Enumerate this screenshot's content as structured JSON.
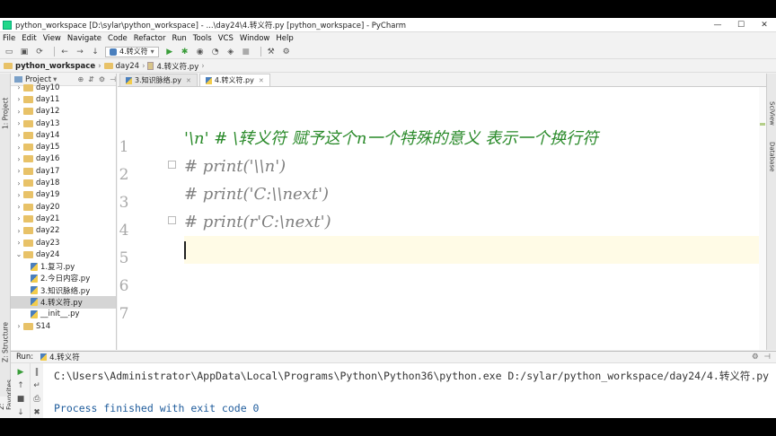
{
  "window": {
    "title": "python_workspace [D:\\sylar\\python_workspace] - ...\\day24\\4.转义符.py [python_workspace] - PyCharm",
    "minimize": "—",
    "maximize": "☐",
    "close": "✕"
  },
  "menu": [
    "File",
    "Edit",
    "View",
    "Navigate",
    "Code",
    "Refactor",
    "Run",
    "Tools",
    "VCS",
    "Window",
    "Help"
  ],
  "toolbar": {
    "run_config": "4.转义符",
    "run_config_arrow": "▾"
  },
  "navbar": {
    "crumbs": [
      "python_workspace",
      "day24",
      "4.转义符.py"
    ]
  },
  "left_tools": {
    "project": "1: Project",
    "structure": "Z: Structure",
    "favorites": "2: Favorites"
  },
  "right_tools": {
    "sciview": "SciView",
    "database": "Database"
  },
  "project_panel": {
    "title": "Project",
    "arrow": "▾",
    "tree": [
      {
        "label": "day10",
        "type": "folder",
        "expanded": false
      },
      {
        "label": "day11",
        "type": "folder",
        "expanded": false
      },
      {
        "label": "day12",
        "type": "folder",
        "expanded": false
      },
      {
        "label": "day13",
        "type": "folder",
        "expanded": false
      },
      {
        "label": "day14",
        "type": "folder",
        "expanded": false
      },
      {
        "label": "day15",
        "type": "folder",
        "expanded": false
      },
      {
        "label": "day16",
        "type": "folder",
        "expanded": false
      },
      {
        "label": "day17",
        "type": "folder",
        "expanded": false
      },
      {
        "label": "day18",
        "type": "folder",
        "expanded": false
      },
      {
        "label": "day19",
        "type": "folder",
        "expanded": false
      },
      {
        "label": "day20",
        "type": "folder",
        "expanded": false
      },
      {
        "label": "day21",
        "type": "folder",
        "expanded": false
      },
      {
        "label": "day22",
        "type": "folder",
        "expanded": false
      },
      {
        "label": "day23",
        "type": "folder",
        "expanded": false
      },
      {
        "label": "day24",
        "type": "folder",
        "expanded": true
      },
      {
        "label": "1.复习.py",
        "type": "file",
        "selected": false
      },
      {
        "label": "2.今日内容.py",
        "type": "file",
        "selected": false
      },
      {
        "label": "3.知识脉络.py",
        "type": "file",
        "selected": false
      },
      {
        "label": "4.转义符.py",
        "type": "file",
        "selected": true
      },
      {
        "label": "__init__.py",
        "type": "file",
        "selected": false
      },
      {
        "label": "S14",
        "type": "folder",
        "expanded": false
      }
    ]
  },
  "editor": {
    "tabs": [
      {
        "label": "3.知识脉络.py",
        "active": false
      },
      {
        "label": "4.转义符.py",
        "active": true
      }
    ],
    "line_numbers": [
      "1",
      "2",
      "3",
      "4",
      "5",
      "6",
      "7"
    ],
    "lines": [
      "'\\n'  # \\转义符 赋予这个n一个特殊的意义 表示一个换行符",
      "# print('\\\\n')",
      "# print('C:\\\\next')",
      "# print(r'C:\\next')",
      "",
      "",
      ""
    ],
    "current_line": 5
  },
  "run_panel": {
    "label": "Run:",
    "config": "4.转义符",
    "command": "C:\\Users\\Administrator\\AppData\\Local\\Programs\\Python\\Python36\\python.exe D:/sylar/python_workspace/day24/4.转义符.py",
    "exit_message": "Process finished with exit code 0"
  }
}
